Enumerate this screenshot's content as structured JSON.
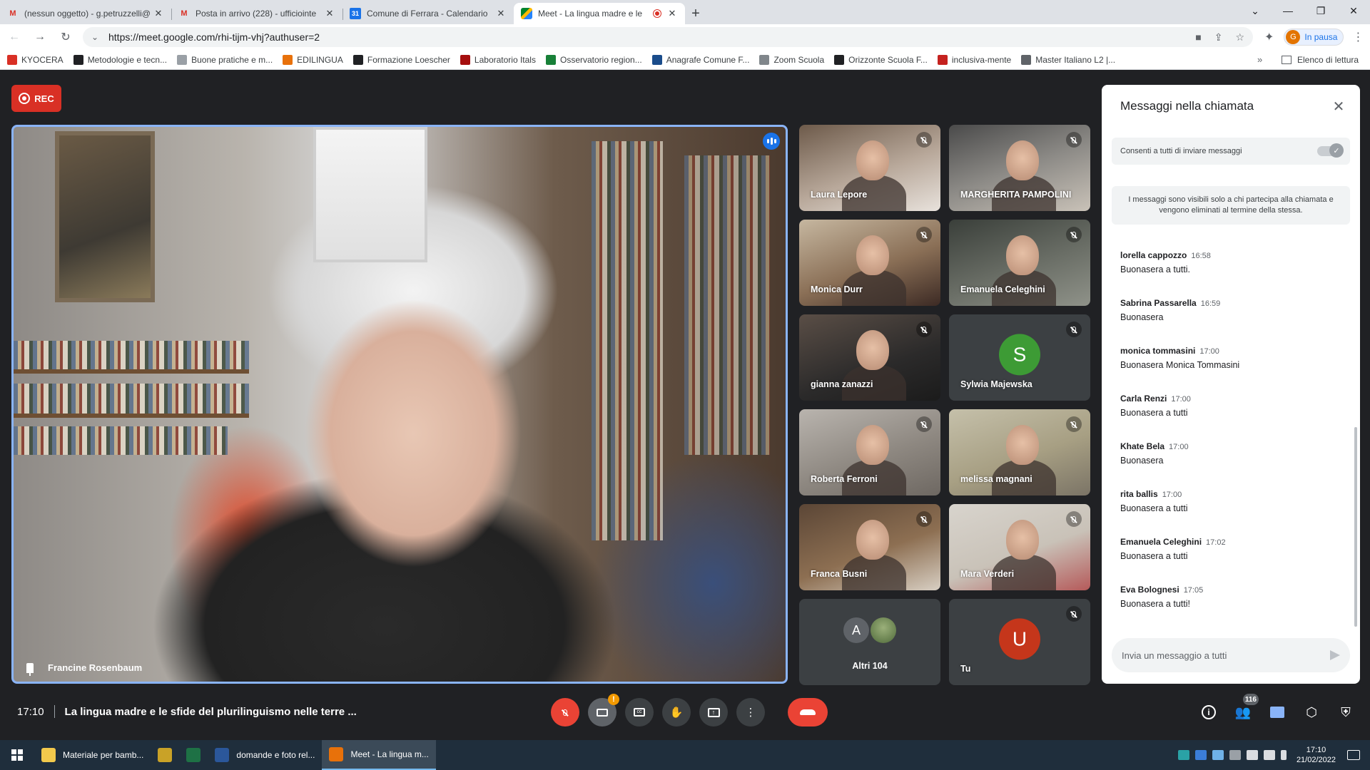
{
  "browser": {
    "tabs": [
      {
        "title": "(nessun oggetto) - g.petruzzelli@",
        "favicon": "gmail-icon"
      },
      {
        "title": "Posta in arrivo (228) - ufficiointe",
        "favicon": "gmail-icon"
      },
      {
        "title": "Comune di Ferrara - Calendario",
        "favicon": "calendar-icon"
      },
      {
        "title": "Meet - La lingua madre e le",
        "favicon": "meet-icon",
        "active": true,
        "recording": true
      }
    ],
    "url": "https://meet.google.com/rhi-tijm-vhj?authuser=2",
    "profile_initial": "G",
    "profile_status": "In pausa",
    "bookmarks": [
      {
        "label": "KYOCERA",
        "color": "#d93025"
      },
      {
        "label": "Metodologie e tecn...",
        "color": "#202124"
      },
      {
        "label": "Buone pratiche e m...",
        "color": "#9aa0a6"
      },
      {
        "label": "EDILINGUA",
        "color": "#e8710a"
      },
      {
        "label": "Formazione Loescher",
        "color": "#202124"
      },
      {
        "label": "Laboratorio Itals",
        "color": "#a50e0e"
      },
      {
        "label": "Osservatorio region...",
        "color": "#188038"
      },
      {
        "label": "Anagrafe Comune F...",
        "color": "#1a4c8b"
      },
      {
        "label": "Zoom Scuola",
        "color": "#80868b"
      },
      {
        "label": "Orizzonte Scuola F...",
        "color": "#202124"
      },
      {
        "label": "inclusiva-mente",
        "color": "#c5221f"
      },
      {
        "label": "Master Italiano L2 |...",
        "color": "#5f6368"
      }
    ],
    "reading_list": "Elenco di lettura",
    "more_bookmarks": "»"
  },
  "meet": {
    "rec_label": "REC",
    "main_speaker": "Francine Rosenbaum",
    "tiles": [
      {
        "name": "Laura Lepore",
        "muted": true
      },
      {
        "name": "MARGHERITA PAMPOLINI",
        "muted": true
      },
      {
        "name": "Monica Durr",
        "muted": true
      },
      {
        "name": "Emanuela Celeghini",
        "muted": true
      },
      {
        "name": "gianna zanazzi",
        "muted": true
      },
      {
        "name": "Sylwia Majewska",
        "initial": "S",
        "avatar_color": "#3d9b35",
        "muted": true
      },
      {
        "name": "Roberta Ferroni",
        "muted": true
      },
      {
        "name": "melissa magnani",
        "muted": true
      },
      {
        "name": "Franca Busni",
        "muted": true
      },
      {
        "name": "Mara Verderi",
        "muted": true
      },
      {
        "name": "Altri 104",
        "initial": "A"
      },
      {
        "name": "Tu",
        "initial": "U",
        "avatar_color": "#c5361b",
        "muted": true
      }
    ],
    "time": "17:10",
    "meeting_title": "La lingua madre e le sfide del plurilinguismo nelle terre ...",
    "participants_count": "116",
    "camera_warning": "!"
  },
  "chat": {
    "title": "Messaggi nella chiamata",
    "allow_label": "Consenti a tutti di inviare messaggi",
    "info": "I messaggi sono visibili solo a chi partecipa alla chiamata e vengono eliminati al termine della stessa.",
    "messages": [
      {
        "sender": "lorella cappozzo",
        "time": "16:58",
        "text": "Buonasera a tutti."
      },
      {
        "sender": "Sabrina Passarella",
        "time": "16:59",
        "text": "Buonasera"
      },
      {
        "sender": "monica tommasini",
        "time": "17:00",
        "text": "Buonasera Monica Tommasini"
      },
      {
        "sender": "Carla Renzi",
        "time": "17:00",
        "text": "Buonasera a tutti"
      },
      {
        "sender": "Khate Bela",
        "time": "17:00",
        "text": "Buonasera"
      },
      {
        "sender": "rita ballis",
        "time": "17:00",
        "text": "Buonasera a tutti"
      },
      {
        "sender": "Emanuela Celeghini",
        "time": "17:02",
        "text": "Buonasera a tutti"
      },
      {
        "sender": "Eva Bolognesi",
        "time": "17:05",
        "text": "Buonasera a tutti!"
      }
    ],
    "input_placeholder": "Invia un messaggio a tutti"
  },
  "taskbar": {
    "items": [
      {
        "label": "Materiale per bamb...",
        "color": "#f2c94c"
      },
      {
        "label": "",
        "color": "#c9a227"
      },
      {
        "label": "",
        "color": "#1e7145"
      },
      {
        "label": "domande e foto rel...",
        "color": "#2b579a"
      },
      {
        "label": "Meet - La lingua m...",
        "color": "#e8710a",
        "active": true
      }
    ],
    "clock_time": "17:10",
    "clock_date": "21/02/2022"
  }
}
